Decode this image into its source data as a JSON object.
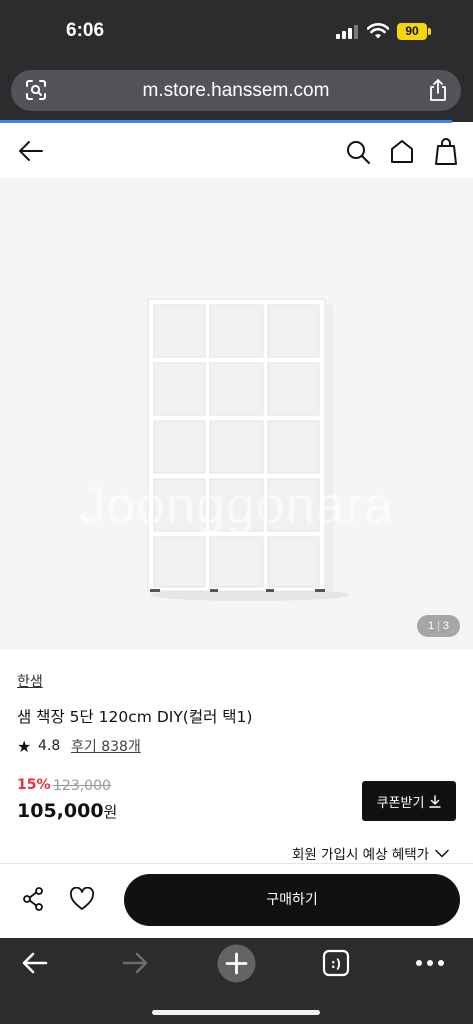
{
  "status_bar": {
    "time": "6:06",
    "battery": "90"
  },
  "browser": {
    "url": "m.store.hanssem.com"
  },
  "product": {
    "brand": "한샘",
    "name": "샘 책장 5단 120cm DIY(컬러 택1)",
    "rating": "4.8",
    "review_label": "후기 838개",
    "discount_rate": "15%",
    "original_price": "123,000",
    "sale_price": "105,000",
    "price_unit": "원",
    "image_counter": {
      "current": "1",
      "total": "3"
    },
    "watermark": "Joonggonara"
  },
  "coupon_button": {
    "label": "쿠폰받기"
  },
  "member_benefit": {
    "label": "회원 가입시 예상 혜택가"
  },
  "buy_button": {
    "label": "구매하기"
  },
  "colors": {
    "accent_discount": "#e8313b",
    "button_dark": "#111111",
    "browser_chrome": "#2c2c2e",
    "battery": "#f4d60b"
  },
  "icons": [
    "lens-icon",
    "share-icon",
    "back-arrow-icon",
    "search-icon",
    "home-icon",
    "shopping-bag-icon",
    "share-nodes-icon",
    "heart-icon",
    "toolbar-back-icon",
    "toolbar-forward-icon",
    "new-tab-plus-icon",
    "tabs-icon",
    "more-icon"
  ]
}
